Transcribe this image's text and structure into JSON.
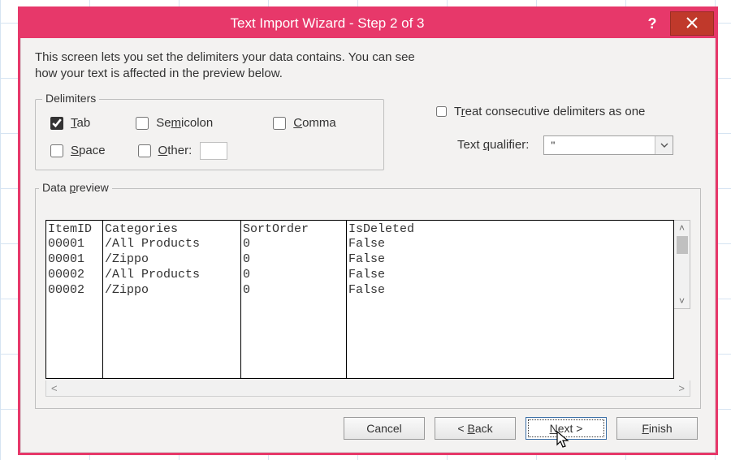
{
  "titlebar": {
    "title": "Text Import Wizard - Step 2 of 3",
    "help": "?",
    "close": "×"
  },
  "instructions": {
    "line1": "This screen lets you set the delimiters your data contains.  You can see",
    "line2": "how your text is affected in the preview below."
  },
  "delimiters": {
    "legend": "Delimiters",
    "tab": {
      "label_pre": "",
      "letter": "T",
      "label_post": "ab",
      "checked": true
    },
    "semicolon": {
      "label_pre": "Se",
      "letter": "m",
      "label_post": "icolon",
      "checked": false
    },
    "comma": {
      "label_pre": "",
      "letter": "C",
      "label_post": "omma",
      "checked": false
    },
    "space": {
      "label_pre": "",
      "letter": "S",
      "label_post": "pace",
      "checked": false
    },
    "other": {
      "label_pre": "",
      "letter": "O",
      "label_post": "ther:",
      "checked": false,
      "value": ""
    }
  },
  "treat_consecutive": {
    "label_pre": "T",
    "letter": "r",
    "label_post": "eat consecutive delimiters as one",
    "checked": false
  },
  "qualifier": {
    "label_pre": "Text ",
    "letter": "q",
    "label_post": "ualifier:",
    "value": "\""
  },
  "preview": {
    "legend_pre": "Data ",
    "legend_letter": "p",
    "legend_post": "review",
    "columns": [
      "ItemID",
      "Categories",
      "SortOrder",
      "IsDeleted"
    ],
    "rows": [
      [
        "00001",
        "/All Products",
        "0",
        "False"
      ],
      [
        "00001",
        "/Zippo",
        "0",
        "False"
      ],
      [
        "00002",
        "/All Products",
        "0",
        "False"
      ],
      [
        "00002",
        "/Zippo",
        "0",
        "False"
      ]
    ]
  },
  "buttons": {
    "cancel": "Cancel",
    "back_pre": "< ",
    "back_letter": "B",
    "back_post": "ack",
    "next_pre": "",
    "next_letter": "N",
    "next_post": "ext >",
    "finish_pre": "",
    "finish_letter": "F",
    "finish_post": "inish"
  }
}
